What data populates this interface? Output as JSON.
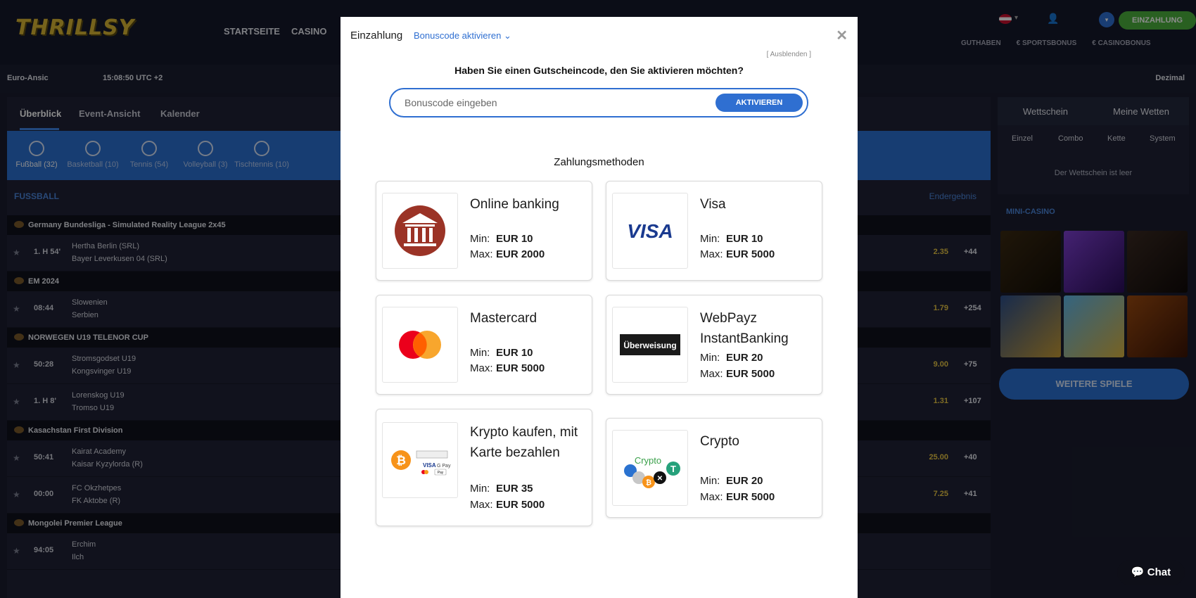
{
  "header": {
    "logo": "THRILLSY",
    "nav": [
      "STARTSEITE",
      "CASINO"
    ],
    "deposit_button": "EINZAHLUNG",
    "balances": [
      "GUTHABEN",
      "€  SPORTSBONUS",
      "€  CASINOBONUS"
    ]
  },
  "subbar": {
    "odds_region": "Euro-Ansic",
    "clock": "15:08:50 UTC +2",
    "odds_format": "Dezimal"
  },
  "tabs": [
    "Überblick",
    "Event-Ansicht",
    "Kalender"
  ],
  "sports": [
    {
      "label": "Fußball (32)"
    },
    {
      "label": "Basketball (10)"
    },
    {
      "label": "Tennis (54)"
    },
    {
      "label": "Volleyball (3)"
    },
    {
      "label": "Tischtennis (10)"
    }
  ],
  "matches": {
    "section": "FUSSBALL",
    "result_label": "Endergebnis",
    "leagues": [
      {
        "name": "Germany Bundesliga - Simulated Reality League 2x45",
        "rows": [
          {
            "time": "1. H 54'",
            "team1": "Hertha Berlin (SRL)",
            "team2": "Bayer Leverkusen 04 (SRL)",
            "odd": "2.35",
            "more": "+44"
          }
        ]
      },
      {
        "name": "EM 2024",
        "rows": [
          {
            "time": "08:44",
            "team1": "Slowenien",
            "team2": "Serbien",
            "odd": "1.79",
            "more": "+254"
          }
        ]
      },
      {
        "name": "NORWEGEN U19 TELENOR CUP",
        "rows": [
          {
            "time": "50:28",
            "team1": "Stromsgodset U19",
            "team2": "Kongsvinger U19",
            "odd": "9.00",
            "more": "+75"
          },
          {
            "time": "1. H 8'",
            "team1": "Lorenskog U19",
            "team2": "Tromso U19",
            "odd": "1.31",
            "more": "+107"
          }
        ]
      },
      {
        "name": "Kasachstan First Division",
        "rows": [
          {
            "time": "50:41",
            "team1": "Kairat Academy",
            "team2": "Kaisar Kyzylorda (R)",
            "odd": "25.00",
            "more": "+40"
          },
          {
            "time": "00:00",
            "team1": "FC Okzhetpes",
            "team2": "FK Aktobe (R)",
            "odd": "7.25",
            "more": "+41"
          }
        ]
      },
      {
        "name": "Mongolei Premier League",
        "rows": [
          {
            "time": "94:05",
            "team1": "Erchim",
            "team2": "Ilch",
            "odd": "",
            "more": ""
          }
        ]
      }
    ]
  },
  "betslip": {
    "tabs": [
      "Wettschein",
      "Meine Wetten"
    ],
    "subtabs": [
      "Einzel",
      "Combo",
      "Kette",
      "System"
    ],
    "empty": "Der Wettschein ist leer",
    "mini_casino": "MINI-CASINO",
    "more_games": "WEITERE SPIELE"
  },
  "chat": "Chat",
  "modal": {
    "title": "Einzahlung",
    "bonus_link": "Bonuscode aktivieren",
    "hide": "[ Ausblenden ]",
    "question": "Haben Sie einen Gutscheincode, den Sie aktivieren möchten?",
    "input_placeholder": "Bonuscode eingeben",
    "activate": "AKTIVIEREN",
    "methods_title": "Zahlungsmethoden",
    "min_label": "Min:",
    "max_label": "Max:",
    "methods": [
      {
        "name": "Online banking",
        "min": "EUR 10",
        "max": "EUR 2000",
        "icon": "bank-icon"
      },
      {
        "name": "Visa",
        "min": "EUR 10",
        "max": "EUR 5000",
        "icon": "visa-logo"
      },
      {
        "name": "Mastercard",
        "min": "EUR 10",
        "max": "EUR 5000",
        "icon": "mastercard-logo"
      },
      {
        "name": "WebPayz InstantBanking",
        "min": "EUR 20",
        "max": "EUR 5000",
        "icon": "ueberweisung-logo",
        "logo_text": "Überweisung"
      },
      {
        "name": "Krypto kaufen, mit Karte bezahlen",
        "min": "EUR 35",
        "max": "EUR 5000",
        "icon": "crypto-card-logo"
      },
      {
        "name": "Crypto",
        "min": "EUR 20",
        "max": "EUR 5000",
        "icon": "crypto-logo",
        "logo_text": "Crypto"
      }
    ]
  },
  "colors": {
    "accent": "#2f6fd1",
    "deposit": "#4caf3d",
    "odd": "#e7c544",
    "bank": "#9b3326"
  }
}
